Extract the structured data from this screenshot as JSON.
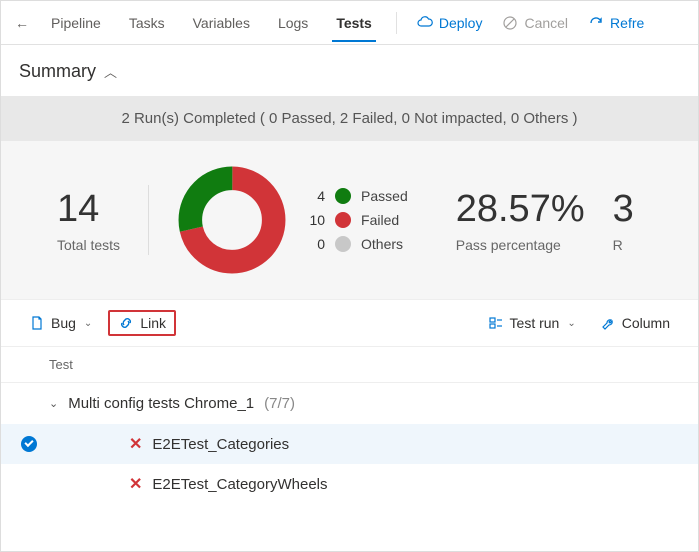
{
  "nav": {
    "tabs": [
      "Pipeline",
      "Tasks",
      "Variables",
      "Logs",
      "Tests"
    ],
    "active": "Tests",
    "deploy": "Deploy",
    "cancel": "Cancel",
    "refresh": "Refre"
  },
  "summary": {
    "title": "Summary",
    "status": "2 Run(s) Completed ( 0 Passed, 2 Failed, 0 Not impacted, 0 Others )"
  },
  "metrics": {
    "total_tests": "14",
    "total_tests_label": "Total tests",
    "pass_pct": "28.57%",
    "pass_pct_label": "Pass percentage",
    "extra_num": "3",
    "extra_label": "R"
  },
  "chart_data": {
    "type": "pie",
    "title": "",
    "series": [
      {
        "name": "Passed",
        "value": 4,
        "color": "#107c10"
      },
      {
        "name": "Failed",
        "value": 10,
        "color": "#d13438"
      },
      {
        "name": "Others",
        "value": 0,
        "color": "#c8c8c8"
      }
    ]
  },
  "legend": {
    "passed": {
      "n": "4",
      "label": "Passed"
    },
    "failed": {
      "n": "10",
      "label": "Failed"
    },
    "others": {
      "n": "0",
      "label": "Others"
    }
  },
  "toolbar": {
    "bug": "Bug",
    "link": "Link",
    "testrun": "Test run",
    "column": "Column"
  },
  "table": {
    "header": "Test",
    "group": {
      "name": "Multi config tests Chrome_1",
      "count": "(7/7)"
    },
    "rows": [
      {
        "name": "E2ETest_Categories"
      },
      {
        "name": "E2ETest_CategoryWheels"
      }
    ]
  }
}
